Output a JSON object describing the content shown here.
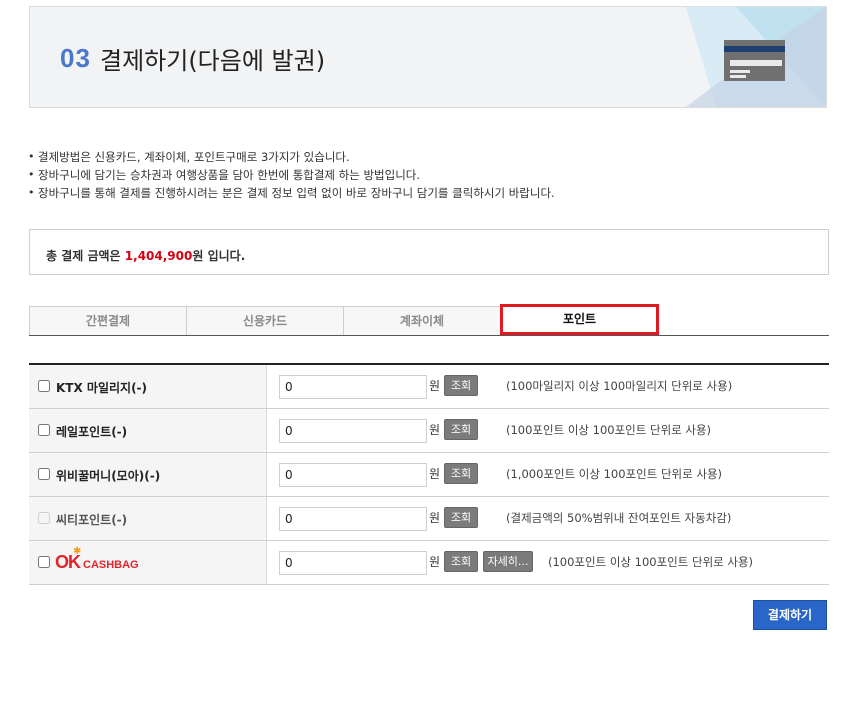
{
  "header": {
    "step": "03",
    "title": "결제하기(다음에 발권)"
  },
  "bullets": [
    "결제방법은 신용카드, 계좌이체, 포인트구매로 3가지가 있습니다.",
    "장바구니에 담기는 승차권과 여행상품을 담아 한번에 통합결제 하는 방법입니다.",
    "장바구니를 통해 결제를 진행하시려는 분은 결제 정보 입력 없이 바로 장바구니 담기를 클릭하시기 바랍니다."
  ],
  "total": {
    "prefix": "총 결제 금액은 ",
    "amount": "1,404,900",
    "suffix": "원 입니다."
  },
  "tabs": [
    {
      "label": "간편결제"
    },
    {
      "label": "신용카드"
    },
    {
      "label": "계좌이체"
    },
    {
      "label": "포인트"
    }
  ],
  "points": [
    {
      "name": "KTX 마일리지(-)",
      "value": "0",
      "won": "원",
      "search": "조회",
      "note": "(100마일리지 이상 100마일리지 단위로 사용)"
    },
    {
      "name": "레일포인트(-)",
      "value": "0",
      "won": "원",
      "search": "조회",
      "note": "(100포인트 이상 100포인트 단위로 사용)"
    },
    {
      "name": "위비꿀머니(모아)(-)",
      "value": "0",
      "won": "원",
      "search": "조회",
      "note": "(1,000포인트 이상 100포인트 단위로 사용)"
    },
    {
      "name": "씨티포인트(-)",
      "value": "0",
      "won": "원",
      "search": "조회",
      "note": "(결제금액의 50%범위내 잔여포인트 자동차감)"
    },
    {
      "name": "OK CASHBAG",
      "logo_ok": "OK",
      "logo_cb": "CASHBAG",
      "value": "0",
      "won": "원",
      "search": "조회",
      "detail": "자세히...",
      "note": "(100포인트 이상 100포인트 단위로 사용)"
    }
  ],
  "pay_button": "결제하기",
  "colors": {
    "accent_blue": "#2a66c7",
    "step_blue": "#4a79c9",
    "amount_red": "#d6000f",
    "active_tab_border": "#e11a22"
  },
  "icons": [
    "credit-card-icon",
    "checkbox-icon"
  ]
}
